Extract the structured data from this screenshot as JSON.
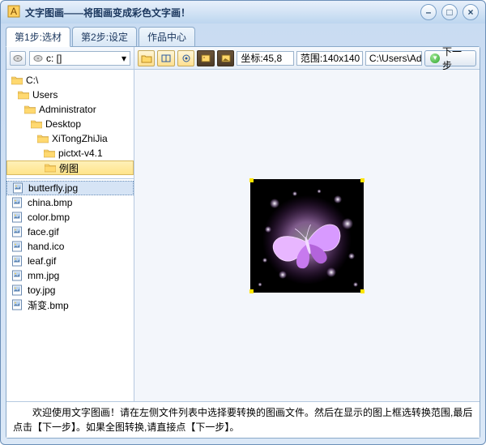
{
  "window": {
    "title": "文字图画——将图画变成彩色文字画！"
  },
  "tabs": [
    "第1步:选材",
    "第2步:设定",
    "作品中心"
  ],
  "drive": {
    "label": "c: []"
  },
  "tree": [
    {
      "label": "C:\\",
      "indent": 6
    },
    {
      "label": "Users",
      "indent": 14
    },
    {
      "label": "Administrator",
      "indent": 22
    },
    {
      "label": "Desktop",
      "indent": 30
    },
    {
      "label": "XiTongZhiJia",
      "indent": 38
    },
    {
      "label": "pictxt-v4.1",
      "indent": 46
    },
    {
      "label": "例图",
      "indent": 46,
      "selected": true
    }
  ],
  "files": [
    {
      "name": "butterfly.jpg",
      "selected": true
    },
    {
      "name": "china.bmp"
    },
    {
      "name": "color.bmp"
    },
    {
      "name": "face.gif"
    },
    {
      "name": "hand.ico"
    },
    {
      "name": "leaf.gif"
    },
    {
      "name": "mm.jpg"
    },
    {
      "name": "toy.jpg"
    },
    {
      "name": "渐变.bmp"
    }
  ],
  "toolbar": {
    "coord_label": "坐标:45,8",
    "range_label": "范围:140x140",
    "path": "C:\\Users\\Adl",
    "next_label": "下一步"
  },
  "status": "　　欢迎使用文字图画！请在左侧文件列表中选择要转换的图画文件。然后在显示的图上框选转换范围,最后点击【下一步】。如果全图转换,请直接点【下一步】。"
}
